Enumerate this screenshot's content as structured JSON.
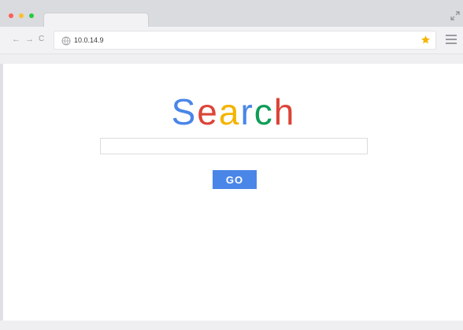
{
  "browser": {
    "url": "10.0.14.9",
    "nav": {
      "back": "←",
      "forward": "→",
      "reload": "C"
    },
    "icons": {
      "traffic_lights": [
        "close-dot",
        "minimize-dot",
        "zoom-dot"
      ],
      "address_bar": "globe-icon",
      "bookmark": "star-icon",
      "menu": "hamburger-menu-icon",
      "window": "expand-icon"
    },
    "colors": {
      "star": "#f5b400",
      "traffic_red": "#ff5f57",
      "traffic_yellow": "#ffbd2e",
      "traffic_green": "#28c940"
    }
  },
  "page": {
    "logo": [
      {
        "char": "S",
        "color": "#4a86e8"
      },
      {
        "char": "e",
        "color": "#db4437"
      },
      {
        "char": "a",
        "color": "#f4b400"
      },
      {
        "char": "r",
        "color": "#4a86e8"
      },
      {
        "char": "c",
        "color": "#0f9d58"
      },
      {
        "char": "h",
        "color": "#db4437"
      }
    ],
    "search": {
      "value": "",
      "placeholder": ""
    },
    "go_label": "GO",
    "colors": {
      "go_button": "#4a86e8"
    }
  }
}
